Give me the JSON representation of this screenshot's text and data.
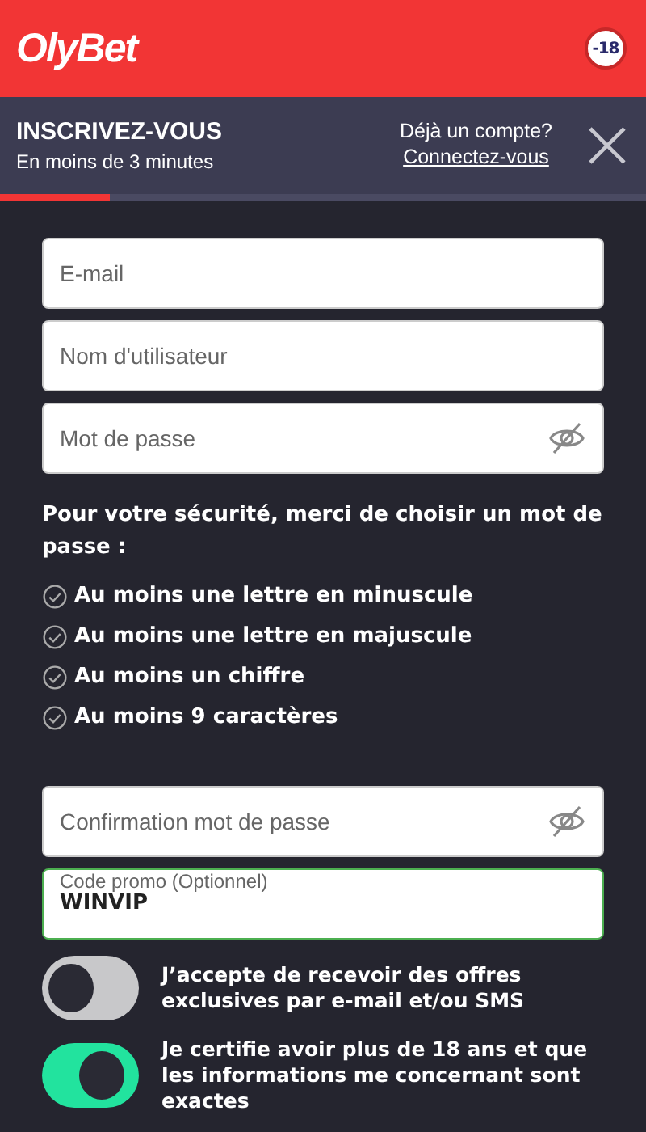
{
  "header": {
    "logo": "OlyBet",
    "age_badge": "-18"
  },
  "signup": {
    "title": "INSCRIVEZ-VOUS",
    "subtitle": "En moins de 3 minutes",
    "account_question": "Déjà un compte?",
    "login_link": "Connectez-vous",
    "progress": {
      "level": 0.17
    }
  },
  "fields": [
    {
      "kind": "text",
      "placeholder": "E-mail"
    },
    {
      "kind": "text",
      "placeholder": "Nom d'utilisateur"
    },
    {
      "kind": "password",
      "placeholder": "Mot de passe"
    }
  ],
  "password_hint": "Pour votre sécurité, merci de choisir un mot de passe :",
  "requirements": [
    "Au moins une lettre en minuscule",
    "Au moins une lettre en majuscule",
    "Au moins un chiffre",
    "Au moins 9 caractères"
  ],
  "fields_2": [
    {
      "kind": "password",
      "placeholder": "Confirmation mot de passe"
    },
    {
      "kind": "labeled",
      "label": "Code promo (Optionnel)",
      "value": "WINVIP"
    }
  ],
  "toggles": [
    {
      "label": "J’accepte de recevoir des offres exclusives par e-mail et/ou SMS",
      "on": false
    },
    {
      "label": "Je certifie avoir plus de 18 ans et que les informations me concernant sont exactes",
      "on": true
    }
  ]
}
